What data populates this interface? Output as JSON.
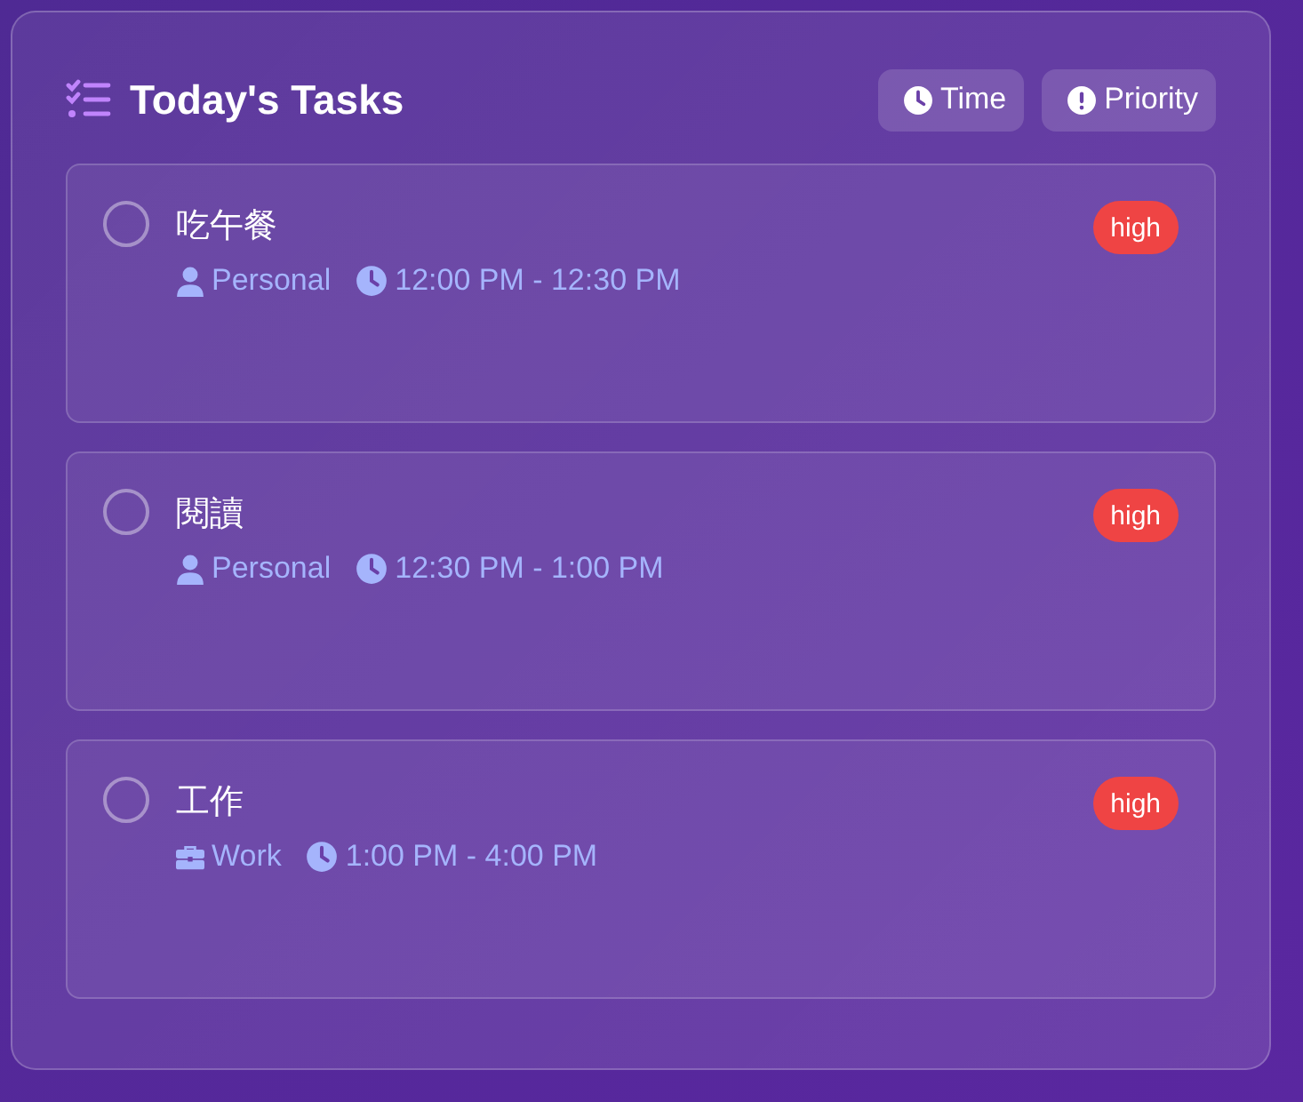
{
  "header": {
    "title": "Today's Tasks",
    "sort_buttons": [
      {
        "kind": "time",
        "label": "Time"
      },
      {
        "kind": "priority",
        "label": "Priority"
      }
    ]
  },
  "tasks": [
    {
      "title": "吃午餐",
      "checked": false,
      "category": {
        "kind": "personal",
        "label": "Personal"
      },
      "time": "12:00 PM - 12:30 PM",
      "priority": "high"
    },
    {
      "title": "閱讀",
      "checked": false,
      "category": {
        "kind": "personal",
        "label": "Personal"
      },
      "time": "12:30 PM - 1:00 PM",
      "priority": "high"
    },
    {
      "title": "工作",
      "checked": false,
      "category": {
        "kind": "work",
        "label": "Work"
      },
      "time": "1:00 PM - 4:00 PM",
      "priority": "high"
    }
  ]
}
